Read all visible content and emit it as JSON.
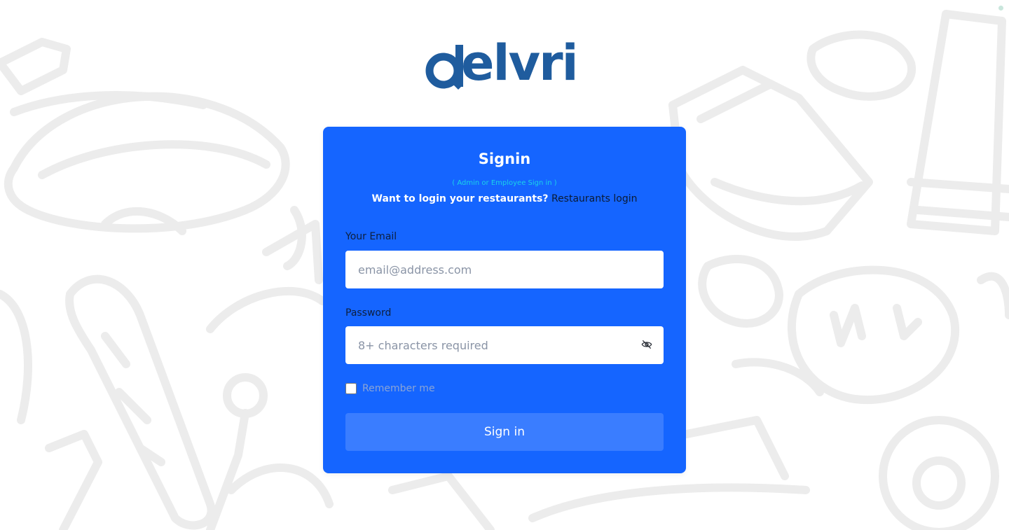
{
  "brand": {
    "logo_text": "elvri",
    "logo_color": "#1f5c9e"
  },
  "card": {
    "title": "Signin",
    "subtitle": "( Admin or Employee Sign in )",
    "restaurant_question": "Want to login your restaurants?",
    "restaurant_link": "Restaurants login",
    "background_color": "#1565ff"
  },
  "form": {
    "email_label": "Your Email",
    "email_placeholder": "email@address.com",
    "email_value": "",
    "password_label": "Password",
    "password_placeholder": "8+ characters required",
    "password_value": "",
    "password_toggle_icon": "eye-off-icon",
    "remember_label": "Remember me",
    "remember_checked": false,
    "submit_label": "Sign in"
  },
  "colors": {
    "accent": "#1565ff",
    "button": "#3a7dff",
    "subtitle": "#1ad4e8"
  }
}
